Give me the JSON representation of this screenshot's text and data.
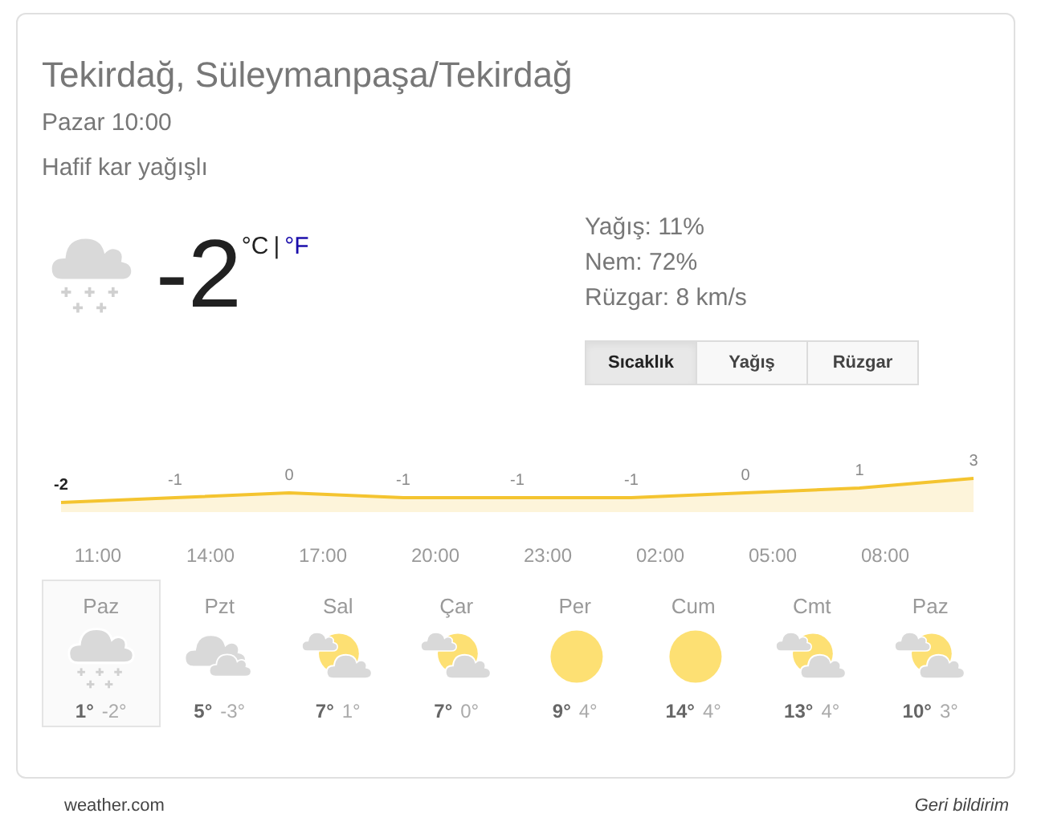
{
  "location": "Tekirdağ, Süleymanpaşa/Tekirdağ",
  "time": "Pazar 10:00",
  "condition": "Hafif kar yağışlı",
  "current": {
    "kind": "snow",
    "temperature": "-2",
    "unit_c": "°C",
    "separator": "|",
    "unit_f": "°F"
  },
  "details": [
    "Yağış: 11%",
    "Nem: 72%",
    "Rüzgar: 8 km/s"
  ],
  "tabs": [
    {
      "label": "Sıcaklık",
      "selected": true
    },
    {
      "label": "Yağış",
      "selected": false
    },
    {
      "label": "Rüzgar",
      "selected": false
    }
  ],
  "chart": {
    "chart_data": {
      "type": "area",
      "series": [
        {
          "color": "#f4c430",
          "values": [
            -2,
            -1,
            0,
            -1,
            -1,
            -1,
            0,
            1,
            3
          ]
        }
      ],
      "data_labels": true
    },
    "times": [
      "11:00",
      "14:00",
      "17:00",
      "20:00",
      "23:00",
      "02:00",
      "05:00",
      "08:00"
    ]
  },
  "days": [
    {
      "day": "Paz",
      "kind": "snow",
      "high": "1°",
      "low": "-2°",
      "selected": true
    },
    {
      "day": "Pzt",
      "kind": "cloudy",
      "high": "5°",
      "low": "-3°",
      "selected": false
    },
    {
      "day": "Sal",
      "kind": "partly_sunny",
      "high": "7°",
      "low": "1°",
      "selected": false
    },
    {
      "day": "Çar",
      "kind": "partly_sunny",
      "high": "7°",
      "low": "0°",
      "selected": false
    },
    {
      "day": "Per",
      "kind": "sunny",
      "high": "9°",
      "low": "4°",
      "selected": false
    },
    {
      "day": "Cum",
      "kind": "sunny",
      "high": "14°",
      "low": "4°",
      "selected": false
    },
    {
      "day": "Cmt",
      "kind": "partly_sunny",
      "high": "13°",
      "low": "4°",
      "selected": false
    },
    {
      "day": "Paz",
      "kind": "partly_sunny",
      "high": "10°",
      "low": "3°",
      "selected": false
    }
  ],
  "footer": {
    "source": "weather.com",
    "feedback": "Geri bildirim"
  }
}
